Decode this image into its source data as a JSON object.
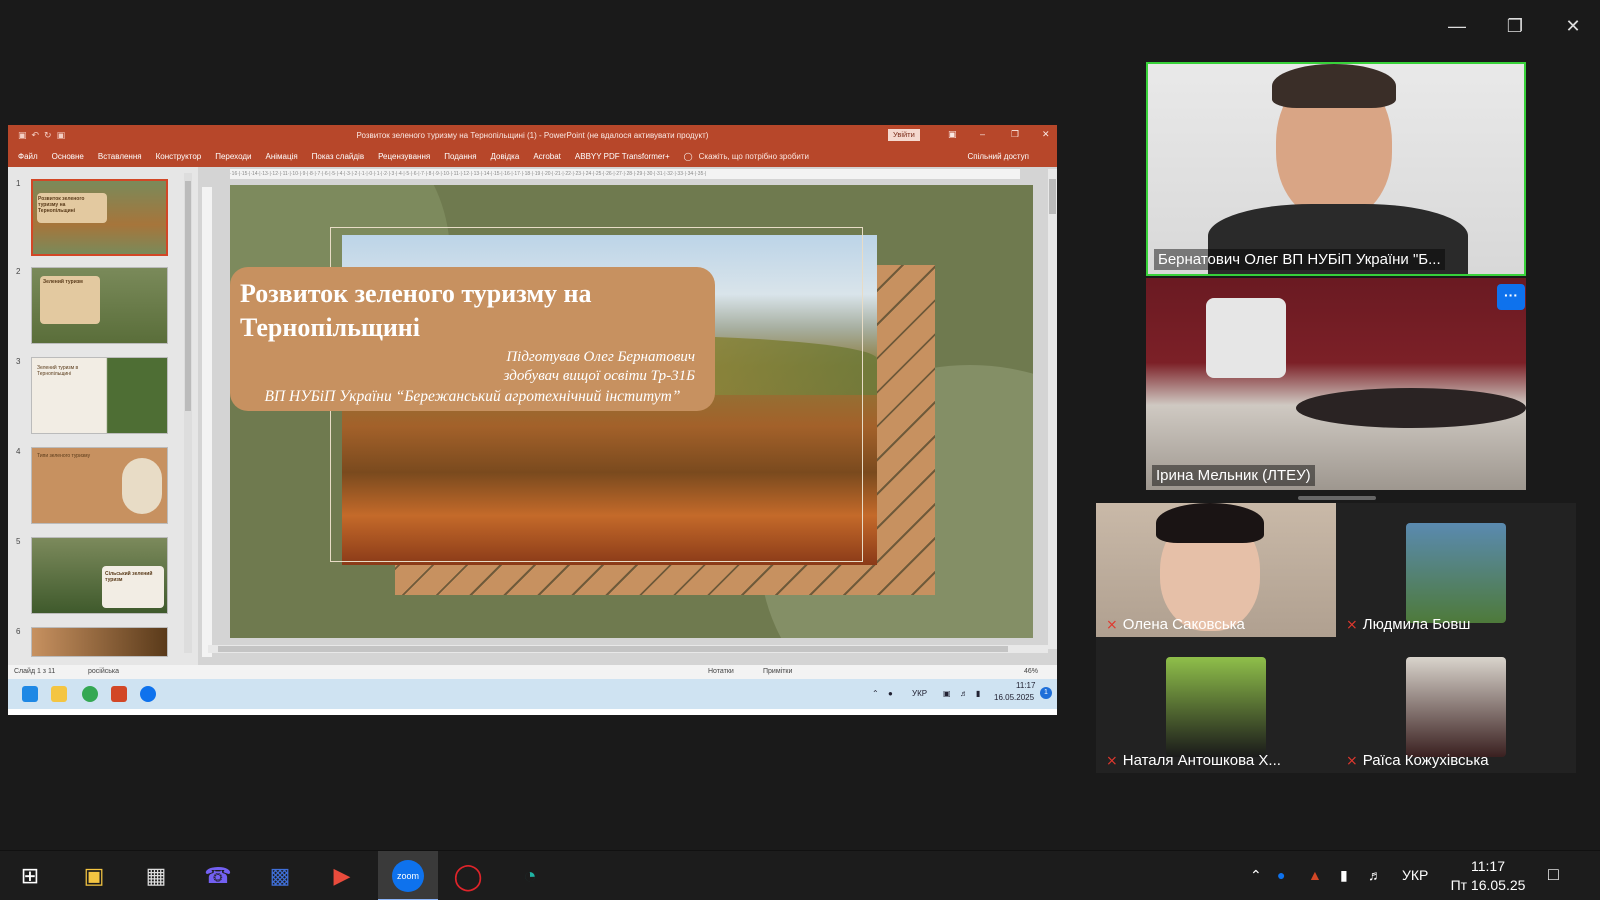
{
  "ppt": {
    "title": "Розвиток зеленого туризму на Тернопільщині  (1)  -  PowerPoint (не вдалося активувати продукт)",
    "signin": "Увійти",
    "tabs": [
      "Файл",
      "Основне",
      "Вставлення",
      "Конструктор",
      "Переходи",
      "Анімація",
      "Показ слайдів",
      "Рецензування",
      "Подання",
      "Довідка",
      "Acrobat",
      "ABBYY PDF Transformer+"
    ],
    "tell_me": "Скажіть, що потрібно зробити",
    "share": "Спільний доступ",
    "ruler": "·16·|·15·|·14·|·13·|·12·|·11·|·10·|·9·|·8·|·7·|·6·|·5·|·4·|·3·|·2·|·1·|·0·|·1·|·2·|·3·|·4·|·5·|·6·|·7·|·8·|·9·|·10·|·11·|·12·|·13·|·14·|·15·|·16·|·17·|·18·|·19·|·20·|·21·|·22·|·23·|·24·|·25·|·26·|·27·|·28·|·29·|·30·|·31·|·32·|·33·|·34·|·35·|",
    "thumbnails": [
      {
        "no": "1",
        "title": "Розвиток зеленого туризму на Тернопільщині"
      },
      {
        "no": "2",
        "title": "Зелений туризм"
      },
      {
        "no": "3",
        "title": "Зелений туризм в Тернопільщині"
      },
      {
        "no": "4",
        "title": "Типи зеленого туризму"
      },
      {
        "no": "5",
        "title": "Сільський зелений туризм"
      },
      {
        "no": "6",
        "title": ""
      }
    ],
    "slide": {
      "title": "Розвиток зеленого туризму на Тернопільщині",
      "line1": "Підготував Олег Бернатович",
      "line2": "здобувач вищої освіти Тр-31Б",
      "line3": "ВП НУБіП України “Бережанський агротехнічний інститут”"
    },
    "status": {
      "slide_count": "Слайд 1 з 11",
      "language": "російська",
      "notes": "Нотатки",
      "comments": "Примітки",
      "zoom": "46%"
    },
    "inner_taskbar": {
      "lang": "УКР",
      "time": "11:17",
      "date": "16.05.2025"
    }
  },
  "participants": {
    "speaker": "Бернатович Олег ВП НУБіП України \"Б...",
    "second": "Ірина Мельник  (ЛТЕУ)",
    "more": "···",
    "grid": [
      {
        "name": "Олена Саковська"
      },
      {
        "name": "Людмила Бовш"
      },
      {
        "name": "Наталя Антошкова Х..."
      },
      {
        "name": "Раїса Кожухівська"
      }
    ]
  },
  "taskbar": {
    "lang": "УКР",
    "time": "11:17",
    "date": "Пт 16.05.25"
  },
  "colors": {
    "ppt_red": "#b7472a",
    "slide_green": "#6f7a4f",
    "slide_tan": "#c79160",
    "active_speaker": "#38d13a",
    "zoom_blue": "#0e72ed",
    "muted_red": "#e0382e"
  }
}
